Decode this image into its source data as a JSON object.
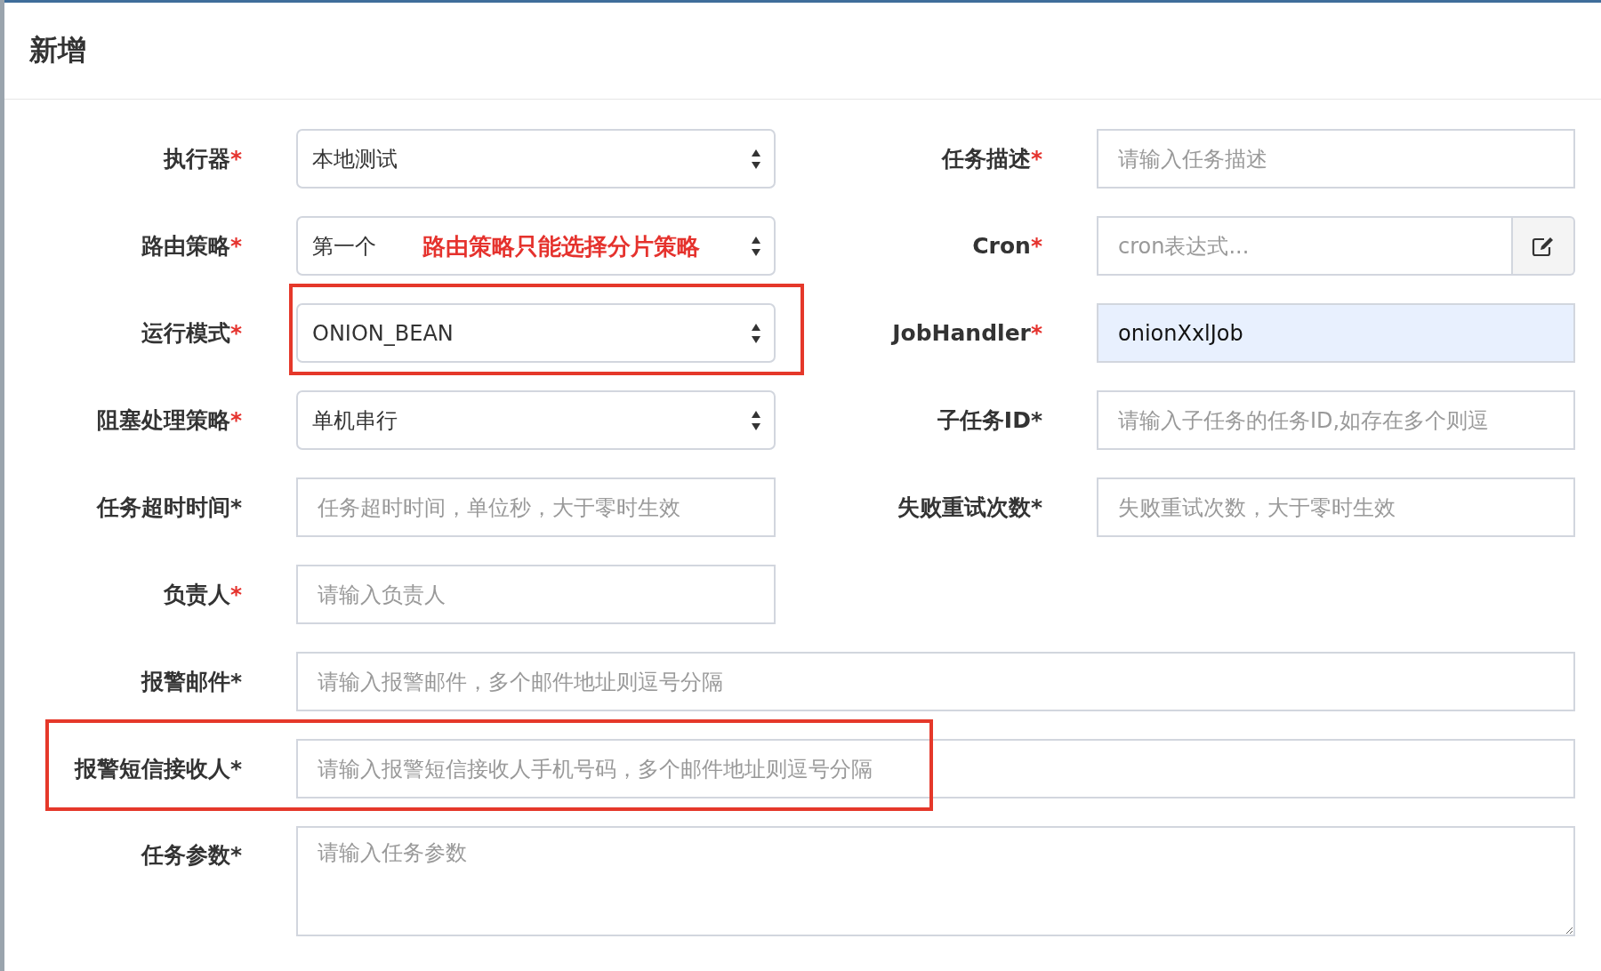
{
  "dialog": {
    "title": "新增"
  },
  "rows": [
    {
      "kind": "pair",
      "fields": [
        {
          "label": "执行器",
          "asterisk": "*",
          "asterisk_red": true,
          "kind": "select",
          "value": "本地测试"
        },
        {
          "label": "任务描述",
          "asterisk": "*",
          "asterisk_red": true,
          "kind": "input",
          "placeholder": "请输入任务描述"
        }
      ]
    },
    {
      "kind": "pair",
      "fields": [
        {
          "label": "路由策略",
          "asterisk": "*",
          "asterisk_red": true,
          "kind": "select",
          "value": "第一个",
          "annotation": "路由策略只能选择分片策略"
        },
        {
          "label": "Cron",
          "asterisk": "*",
          "asterisk_red": true,
          "kind": "addon",
          "placeholder": "cron表达式..."
        }
      ]
    },
    {
      "kind": "pair",
      "fields": [
        {
          "label": "运行模式",
          "asterisk": "*",
          "asterisk_red": true,
          "kind": "select",
          "value": "ONION_BEAN",
          "highlight": true
        },
        {
          "label": "JobHandler",
          "asterisk": "*",
          "asterisk_red": true,
          "kind": "input",
          "value": "onionXxlJob",
          "autofilled": true
        }
      ]
    },
    {
      "kind": "pair",
      "fields": [
        {
          "label": "阻塞处理策略",
          "asterisk": "*",
          "asterisk_red": true,
          "kind": "select",
          "value": "单机串行"
        },
        {
          "label": "子任务ID",
          "asterisk": "*",
          "asterisk_red": false,
          "kind": "input",
          "placeholder": "请输入子任务的任务ID,如存在多个则逗"
        }
      ]
    },
    {
      "kind": "pair",
      "fields": [
        {
          "label": "任务超时时间",
          "asterisk": "*",
          "asterisk_red": false,
          "kind": "input",
          "placeholder": "任务超时时间，单位秒，大于零时生效"
        },
        {
          "label": "失败重试次数",
          "asterisk": "*",
          "asterisk_red": false,
          "kind": "input",
          "placeholder": "失败重试次数，大于零时生效"
        }
      ]
    },
    {
      "kind": "pair",
      "fields": [
        {
          "label": "负责人",
          "asterisk": "*",
          "asterisk_red": true,
          "kind": "input",
          "placeholder": "请输入负责人"
        }
      ]
    },
    {
      "kind": "wide",
      "fields": [
        {
          "label": "报警邮件",
          "asterisk": "*",
          "asterisk_red": false,
          "kind": "input",
          "placeholder": "请输入报警邮件，多个邮件地址则逗号分隔"
        }
      ]
    },
    {
      "kind": "wide",
      "fields": [
        {
          "label": "报警短信接收人",
          "asterisk": "*",
          "asterisk_red": false,
          "kind": "input",
          "placeholder": "请输入报警短信接收人手机号码，多个邮件地址则逗号分隔",
          "highlight": true
        }
      ]
    },
    {
      "kind": "wide",
      "fields": [
        {
          "label": "任务参数",
          "asterisk": "*",
          "asterisk_red": false,
          "kind": "textarea",
          "placeholder": "请输入任务参数"
        }
      ]
    }
  ]
}
